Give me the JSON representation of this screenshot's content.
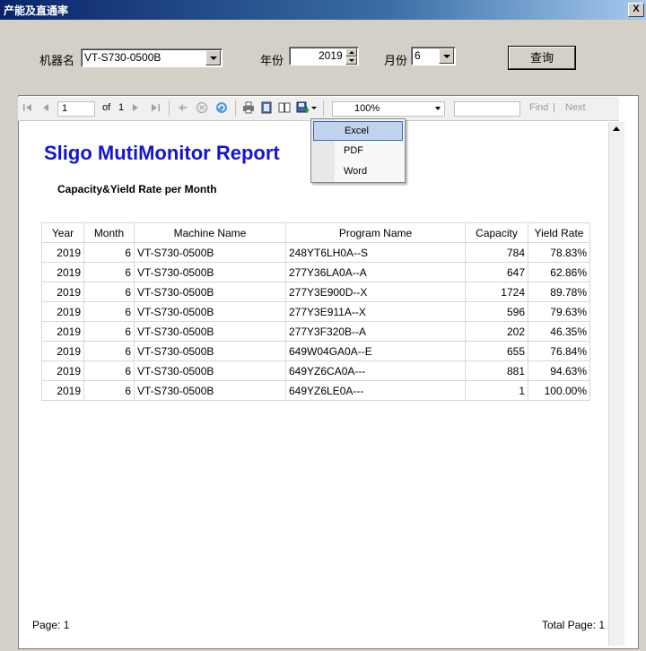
{
  "window": {
    "title": "产能及直通率",
    "close_label": "X"
  },
  "filters": {
    "machine_label": "机器名",
    "machine_value": "VT-S730-0500B",
    "year_label": "年份",
    "year_value": "2019",
    "month_label": "月份",
    "month_value": "6",
    "query_label": "查询"
  },
  "toolbar": {
    "page_value": "1",
    "of_label": "of",
    "page_total": "1",
    "zoom_value": "100%",
    "find_label": "Find",
    "next_label": "Next"
  },
  "export_menu": {
    "items": [
      "Excel",
      "PDF",
      "Word"
    ]
  },
  "report": {
    "title": "Sligo MutiMonitor Report",
    "subtitle": "Capacity&Yield Rate per Month",
    "columns": [
      "Year",
      "Month",
      "Machine Name",
      "Program Name",
      "Capacity",
      "Yield Rate"
    ],
    "rows": [
      [
        "2019",
        "6",
        "VT-S730-0500B",
        "248YT6LH0A--S",
        "784",
        "78.83%"
      ],
      [
        "2019",
        "6",
        "VT-S730-0500B",
        "277Y36LA0A--A",
        "647",
        "62.86%"
      ],
      [
        "2019",
        "6",
        "VT-S730-0500B",
        "277Y3E900D--X",
        "1724",
        "89.78%"
      ],
      [
        "2019",
        "6",
        "VT-S730-0500B",
        "277Y3E911A--X",
        "596",
        "79.63%"
      ],
      [
        "2019",
        "6",
        "VT-S730-0500B",
        "277Y3F320B--A",
        "202",
        "46.35%"
      ],
      [
        "2019",
        "6",
        "VT-S730-0500B",
        "649W04GA0A--E",
        "655",
        "76.84%"
      ],
      [
        "2019",
        "6",
        "VT-S730-0500B",
        "649YZ6CA0A---",
        "881",
        "94.63%"
      ],
      [
        "2019",
        "6",
        "VT-S730-0500B",
        "649YZ6LE0A---",
        "1",
        "100.00%"
      ]
    ],
    "page_label": "Page: 1",
    "total_page_label": "Total Page: 1"
  },
  "colors": {
    "title_blue": "#1414d2",
    "window_bg": "#d4d0c8",
    "menu_highlight": "#c1d2ee"
  }
}
